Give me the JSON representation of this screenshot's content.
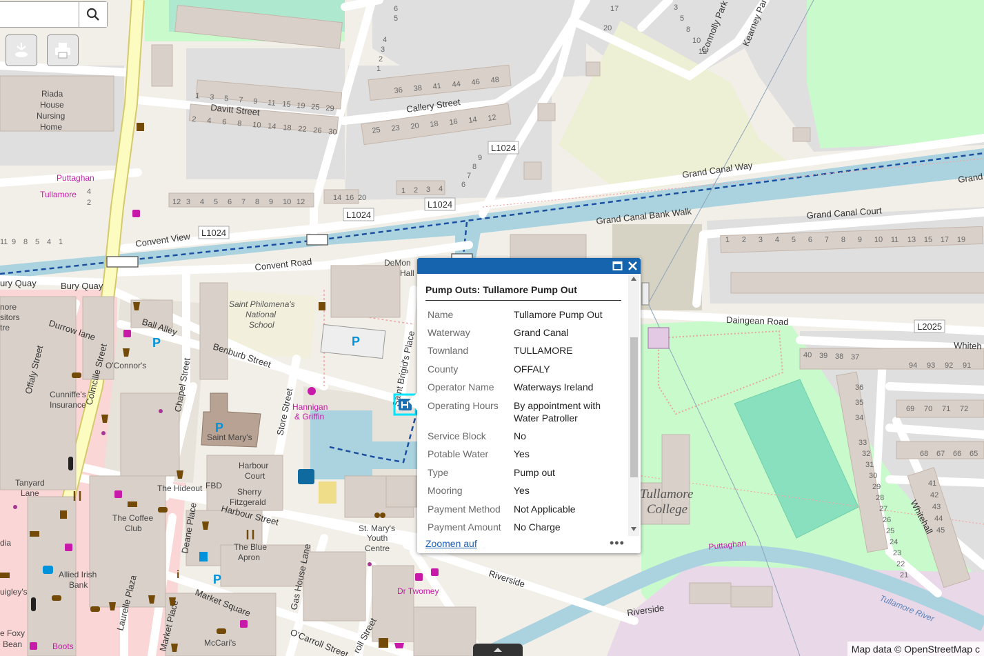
{
  "search": {
    "placeholder": "",
    "value": ""
  },
  "toolbar": {
    "locate_icon": "locate-icon",
    "print_icon": "print-icon"
  },
  "map": {
    "streets": {
      "davitt": "Davitt Street",
      "callery": "Callery Street",
      "grand_canal_way": "Grand Canal Way",
      "grand_canal_east": "Grand",
      "grand_canal_bank_walk": "Grand Canal Bank Walk",
      "grand_canal_court": "Grand Canal Court",
      "convent_view": "Convent View",
      "convent_road": "Convent Road",
      "l1024_a": "L1024",
      "l1024_b": "L1024",
      "l1024_c": "L1024",
      "l1024_d": "L1024",
      "bury_quay_a": "ury Quay",
      "bury_quay_b": "Bury Quay",
      "durrow_lane": "Durrow lane",
      "ball_alley": "Ball Alley",
      "benburb": "Benburb Street",
      "colmcille": "Colmcille Street",
      "offaly": "Offaly Street",
      "chapel": "Chapel Street",
      "store": "Store Street",
      "st_brigids": "Saint Brigid's Place",
      "daingean": "Daingean Road",
      "l2025": "L2025",
      "whitehall_e": "Whiteh",
      "whitehall": "Whitehall",
      "harbour": "Harbour Street",
      "deane": "Deane Place",
      "market_sq": "Market Square",
      "market_pl": "Market Place",
      "laurelle": "Laurelle Plaza",
      "gas_house": "Gas House Lane",
      "ocarroll": "O'Carroll Street",
      "roll": "roll Street",
      "riverside_a": "Riverside",
      "riverside_b": "Riverside",
      "connolly": "Connolly Park",
      "kearney": "Kearney Park",
      "puttaghan_w": "Puttaghan",
      "tullamore_w": "Tullamore",
      "puttaghan_e": "Puttaghan"
    },
    "places": {
      "riada1": "Riada",
      "riada2": "House",
      "riada3": "Nursing",
      "riada4": "Home",
      "st_philomena1": "Saint Philomena's",
      "st_philomena2": "National",
      "st_philomena3": "School",
      "st_marys": "Saint Mary's",
      "demontfort1": "DeMon",
      "demontfort2": "Hall",
      "hannigan1": "Hannigan",
      "hannigan2": "& Griffin",
      "harbour_court1": "Harbour",
      "harbour_court2": "Court",
      "the_hideout": "The Hideout",
      "fbd": "FBD",
      "sherry1": "Sherry",
      "sherry2": "Fitzgerald",
      "coffee1": "The Coffee",
      "coffee2": "Club",
      "blue_apron1": "The Blue",
      "blue_apron2": "Apron",
      "allied1": "Allied Irish",
      "allied2": "Bank",
      "st_marys_youth1": "St. Mary's",
      "st_marys_youth2": "Youth",
      "st_marys_youth3": "Centre",
      "dr_twomey": "Dr Twomey",
      "mccaris": "McCari's",
      "boots": "Boots",
      "foxy_bean1": "e Foxy",
      "foxy_bean2": "Bean",
      "tanyard1": "Tanyard",
      "tanyard2": "Lane",
      "cunniffes1": "Cunniffe's",
      "cunniffes2": "Insurance",
      "oconnors": "O'Connor's",
      "tullamore_college1": "Tullamore",
      "tullamore_college2": "College",
      "tullamore_river": "Tullamore River",
      "visitors1": "nore",
      "visitors2": "sitors",
      "visitors3": "tre",
      "uigley": "uigley's",
      "dia": "dia"
    },
    "house_numbers": {
      "davitt_n": [
        "1",
        "3",
        "5",
        "7",
        "9",
        "11",
        "15",
        "19",
        "25",
        "29"
      ],
      "davitt_s": [
        "2",
        "4",
        "6",
        "8",
        "10",
        "14",
        "18",
        "22",
        "26",
        "30"
      ],
      "callery_n": [
        "36",
        "38",
        "41",
        "44",
        "46",
        "48"
      ],
      "callery_s": [
        "25",
        "23",
        "20",
        "18",
        "16",
        "14",
        "12"
      ],
      "cv": [
        "12",
        "3",
        "4",
        "5",
        "6",
        "7",
        "8",
        "9",
        "10",
        "12"
      ],
      "cv2": [
        "14",
        "16",
        "20"
      ],
      "cv3": [
        "1",
        "2",
        "3",
        "4"
      ],
      "diag": [
        "9",
        "8",
        "7",
        "6"
      ],
      "top1": [
        "6",
        "5"
      ],
      "top2": [
        "4",
        "3",
        "2",
        "1"
      ],
      "top3": [
        "17",
        "20"
      ],
      "top4": [
        "3",
        "5",
        "8",
        "10",
        "12"
      ],
      "gcc": [
        "1",
        "2",
        "3",
        "4",
        "5",
        "6",
        "7",
        "8",
        "9",
        "10",
        "11",
        "13",
        "15",
        "17",
        "19"
      ],
      "daingean_n": [
        "40",
        "39",
        "38",
        "37"
      ],
      "block_a": [
        "94",
        "93",
        "92",
        "91"
      ],
      "block_b": [
        "69",
        "70",
        "71",
        "72"
      ],
      "block_c": [
        "68",
        "67",
        "66",
        "65"
      ],
      "col36": [
        "36",
        "35",
        "34"
      ],
      "col33": [
        "33",
        "32",
        "31",
        "30",
        "29",
        "28",
        "27",
        "26",
        "25",
        "24",
        "23",
        "22",
        "21"
      ],
      "col41": [
        "41",
        "42",
        "43",
        "44",
        "45"
      ],
      "west_a": [
        "11",
        "9",
        "8",
        "5",
        "4",
        "1"
      ],
      "west_b": [
        "4",
        "2"
      ]
    },
    "road_refs": {}
  },
  "popup": {
    "title": "Pump Outs: Tullamore Pump Out",
    "attributes": [
      {
        "key": "Name",
        "value": "Tullamore Pump Out"
      },
      {
        "key": "Waterway",
        "value": "Grand Canal"
      },
      {
        "key": "Townland",
        "value": "TULLAMORE"
      },
      {
        "key": "County",
        "value": "OFFALY"
      },
      {
        "key": "Operator Name",
        "value": "Waterways Ireland"
      },
      {
        "key": "Operating Hours",
        "value": "By appointment with Water Patroller"
      },
      {
        "key": "Service Block",
        "value": "No"
      },
      {
        "key": "Potable Water",
        "value": "Yes"
      },
      {
        "key": "Type",
        "value": "Pump out"
      },
      {
        "key": "Mooring",
        "value": "Yes"
      },
      {
        "key": "Payment Method",
        "value": "Not Applicable"
      },
      {
        "key": "Payment Amount",
        "value": "No Charge"
      }
    ],
    "zoom_label": "Zoomen auf",
    "more_label": "•••",
    "header_color": "#1664ad"
  },
  "attribution": "Map data © OpenStreetMap c",
  "colors": {
    "canal": "#aad3df",
    "park": "#c8facc",
    "pitch": "#88e0be",
    "land": "#f2efe9",
    "building": "#d9d0c9",
    "residential": "#e0dfdf",
    "retail": "#fbd6d6",
    "primary_road": "#fcfcc0",
    "canal_path": "#1c4fa0"
  }
}
